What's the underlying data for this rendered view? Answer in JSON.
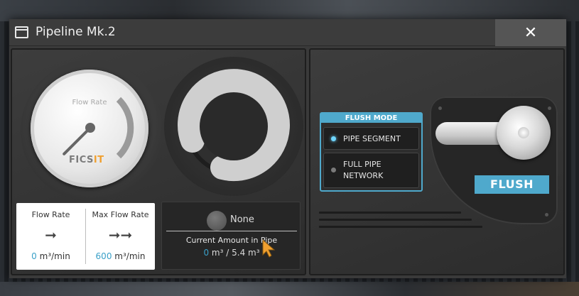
{
  "window": {
    "title": "Pipeline Mk.2",
    "close_label": "✕"
  },
  "gauge": {
    "label": "Flow Rate",
    "brand_prefix": "FICS",
    "brand_suffix": "IT",
    "needle_fraction": 0.0
  },
  "flow": {
    "flow_rate_title": "Flow Rate",
    "flow_rate_value": "0",
    "max_flow_rate_title": "Max Flow Rate",
    "max_flow_rate_value": "600",
    "unit": "m³/min",
    "arrow_single": "➞",
    "arrow_double": "➞➞"
  },
  "amount": {
    "fluid_name": "None",
    "title": "Current Amount in Pipe",
    "current": "0",
    "max": "5.4",
    "unit": "m³",
    "separator": "/"
  },
  "flush_mode": {
    "header": "FLUSH MODE",
    "options": [
      {
        "label": "PIPE SEGMENT",
        "selected": true
      },
      {
        "label": "FULL PIPE NETWORK",
        "selected": false
      }
    ]
  },
  "flush_button": {
    "label": "FLUSH"
  },
  "colors": {
    "accent": "#4fa9cc",
    "value_blue": "#3aa0c8",
    "panel": "#3a3a3a"
  }
}
